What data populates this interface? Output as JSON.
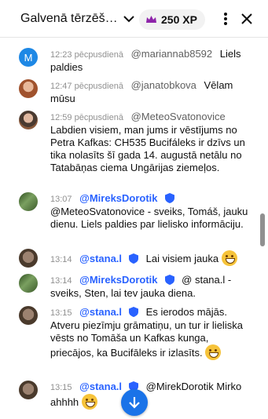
{
  "header": {
    "title": "Galvenā tērzēšana",
    "xp": "250 XP",
    "colors": {
      "crown": "#8e24aa"
    }
  },
  "messages": [
    {
      "time": "12:23 pēcpusdienā",
      "author": "@mariannab8592",
      "text": "Liels paldies",
      "avatar_letter": "M",
      "avatar_color": "#1e88e5"
    },
    {
      "time": "12:47 pēcpusdienā",
      "author": "@janatobkova",
      "text": "Vēlam mūsu",
      "avatar_color": "#a0522d"
    },
    {
      "time": "12:59 pēcpusdienā",
      "author": "@MeteoSvatonovice",
      "text": "Labdien visiem, man jums ir vēstījums no Petra Kafkas: CH535 Bucifáleks ir dzīvs un tika nolasīts šī gada 14. augustā netālu no Tatabāņas ciema Ungārijas ziemeļos.",
      "avatar_color": "#8b5a3c"
    },
    {
      "time": "13:07",
      "author": "@MireksDorotik",
      "text": "@MeteoSvatonovice - sveiks, Tomáš, jauku dienu. Liels paldies par lielisko informāciju.",
      "avatar_color": "#556b2f"
    },
    {
      "time": "13:14",
      "author": "@stana.l",
      "text": "Lai visiem jauka",
      "avatar_color": "#6b4c3b"
    },
    {
      "time": "13:14",
      "author": "@MireksDorotik",
      "text": "@ stana.l - sveiks, Sten, lai tev jauka diena.",
      "avatar_color": "#556b2f"
    },
    {
      "time": "13:15",
      "author": "@stana.l",
      "text": "Es ierodos mājās. Atveru piezīmju grāmatiņu, un tur ir lieliska vēsts no Tomāša un Kafkas kunga, priecājos, ka Bucifāleks ir izlasīts.",
      "avatar_color": "#6b4c3b"
    },
    {
      "time": "13:15",
      "author": "@stana.l",
      "text": "@MirekDorotik Mirko ahhhh",
      "avatar_color": "#6b4c3b"
    }
  ]
}
